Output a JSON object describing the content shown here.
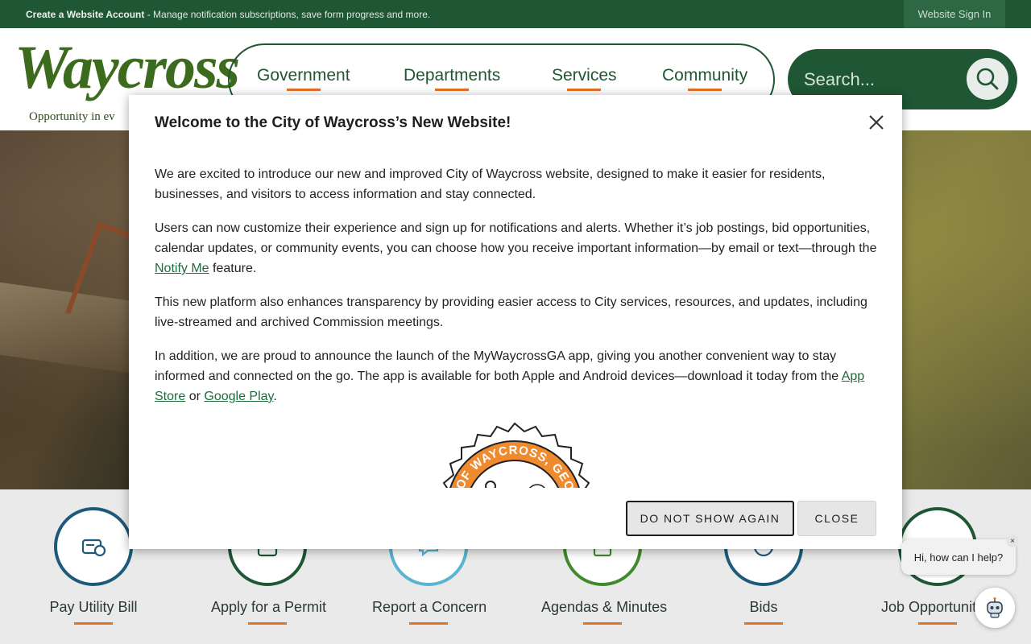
{
  "topbar": {
    "create_bold": "Create a Website Account",
    "create_rest": " - Manage notification subscriptions, save form progress and more.",
    "signin": "Website Sign In"
  },
  "logo": {
    "word": "Waycross",
    "tagline": "Opportunity in ev"
  },
  "nav": {
    "items": [
      {
        "label": "Government"
      },
      {
        "label": "Departments"
      },
      {
        "label": "Services"
      },
      {
        "label": "Community"
      }
    ]
  },
  "search": {
    "placeholder": "Search..."
  },
  "quick_links": [
    {
      "label": "Pay Utility Bill"
    },
    {
      "label": "Apply for a Permit"
    },
    {
      "label": "Report a Concern"
    },
    {
      "label": "Agendas & Minutes"
    },
    {
      "label": "Bids"
    },
    {
      "label": "Job Opportunit"
    }
  ],
  "modal": {
    "title": "Welcome to the City of Waycross’s New Website!",
    "p1": "We are excited to introduce our new and improved City of Waycross website, designed to make it easier for residents, businesses, and visitors to access information and stay connected.",
    "p2_before": "Users can now customize their experience and sign up for notifications and alerts. Whether it’s job postings, bid opportunities, calendar updates, or community events, you can choose how you receive important information—by email or text—through the ",
    "p2_link": "Notify Me",
    "p2_after": " feature.",
    "p3": "This new platform also enhances transparency by providing easier access to City services, resources, and updates, including live-streamed and archived Commission meetings.",
    "p4_before": "In addition, we are proud to announce the launch of the MyWaycrossGA app, giving you another convenient way to stay informed and connected on the go. The app is available for both Apple and Android devices—download it today from the ",
    "p4_link1": "App Store",
    "p4_mid": " or ",
    "p4_link2": "Google Play",
    "p4_after": ".",
    "seal_text": "L OF WAYCROSS, GEOR",
    "btn_do_not_show": "DO NOT SHOW AGAIN",
    "btn_close": "CLOSE"
  },
  "chat": {
    "bubble": "Hi, how can I help?",
    "dismiss": "×"
  },
  "colors": {
    "brand_green": "#1f5634",
    "accent_orange": "#e37127",
    "link_green": "#1f6b3c"
  }
}
